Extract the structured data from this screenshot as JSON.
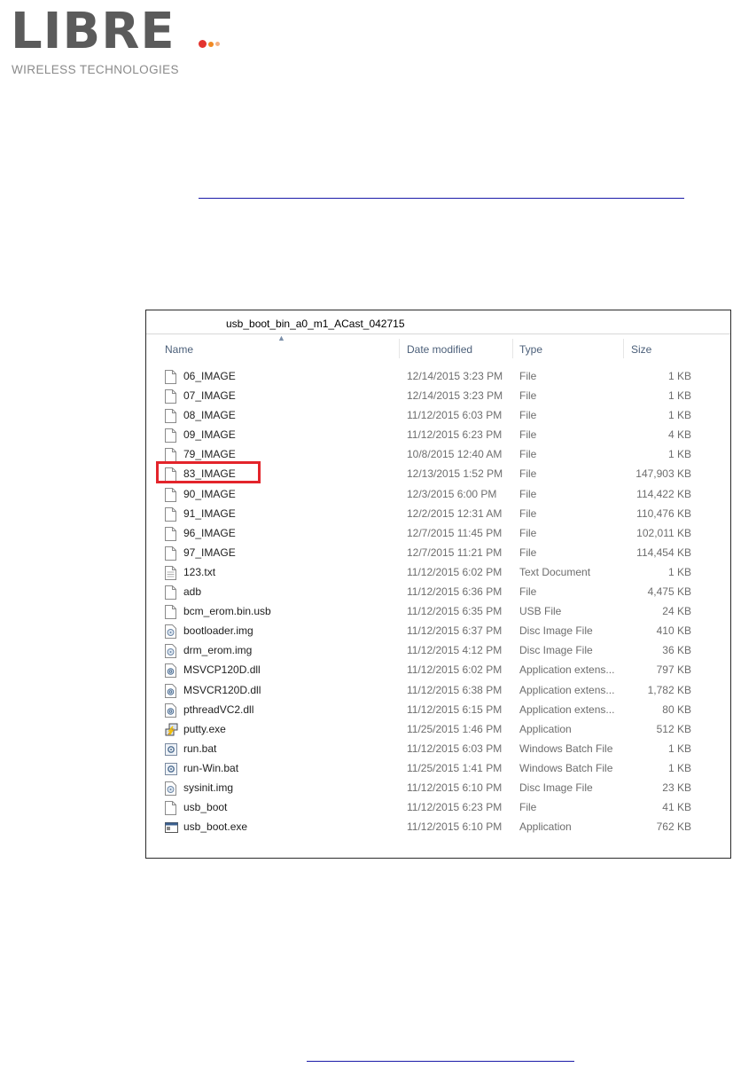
{
  "logo": {
    "wordmark": "LIBRE",
    "tagline": "WIRELESS TECHNOLOGIES",
    "dot_colors": [
      "#e3342f",
      "#f08a24",
      "#f4b183"
    ]
  },
  "explorer": {
    "folder_name": "usb_boot_bin_a0_m1_ACast_042715",
    "columns": {
      "name": "Name",
      "date": "Date modified",
      "type": "Type",
      "size": "Size"
    },
    "highlighted_file": "83_IMAGE",
    "highlight_color": "#e3242b",
    "files": [
      {
        "name": "06_IMAGE",
        "date": "12/14/2015 3:23 PM",
        "type": "File",
        "size": "1 KB",
        "icon": "blank-file-icon"
      },
      {
        "name": "07_IMAGE",
        "date": "12/14/2015 3:23 PM",
        "type": "File",
        "size": "1 KB",
        "icon": "blank-file-icon"
      },
      {
        "name": "08_IMAGE",
        "date": "11/12/2015 6:03 PM",
        "type": "File",
        "size": "1 KB",
        "icon": "blank-file-icon"
      },
      {
        "name": "09_IMAGE",
        "date": "11/12/2015 6:23 PM",
        "type": "File",
        "size": "4 KB",
        "icon": "blank-file-icon"
      },
      {
        "name": "79_IMAGE",
        "date": "10/8/2015 12:40 AM",
        "type": "File",
        "size": "1 KB",
        "icon": "blank-file-icon"
      },
      {
        "name": "83_IMAGE",
        "date": "12/13/2015 1:52 PM",
        "type": "File",
        "size": "147,903 KB",
        "icon": "blank-file-icon"
      },
      {
        "name": "90_IMAGE",
        "date": "12/3/2015 6:00 PM",
        "type": "File",
        "size": "114,422 KB",
        "icon": "blank-file-icon"
      },
      {
        "name": "91_IMAGE",
        "date": "12/2/2015 12:31 AM",
        "type": "File",
        "size": "110,476 KB",
        "icon": "blank-file-icon"
      },
      {
        "name": "96_IMAGE",
        "date": "12/7/2015 11:45 PM",
        "type": "File",
        "size": "102,011 KB",
        "icon": "blank-file-icon"
      },
      {
        "name": "97_IMAGE",
        "date": "12/7/2015 11:21 PM",
        "type": "File",
        "size": "114,454 KB",
        "icon": "blank-file-icon"
      },
      {
        "name": "123.txt",
        "date": "11/12/2015 6:02 PM",
        "type": "Text Document",
        "size": "1 KB",
        "icon": "text-file-icon"
      },
      {
        "name": "adb",
        "date": "11/12/2015 6:36 PM",
        "type": "File",
        "size": "4,475 KB",
        "icon": "blank-file-icon"
      },
      {
        "name": "bcm_erom.bin.usb",
        "date": "11/12/2015 6:35 PM",
        "type": "USB File",
        "size": "24 KB",
        "icon": "blank-file-icon"
      },
      {
        "name": "bootloader.img",
        "date": "11/12/2015 6:37 PM",
        "type": "Disc Image File",
        "size": "410 KB",
        "icon": "disc-image-icon"
      },
      {
        "name": "drm_erom.img",
        "date": "11/12/2015 4:12 PM",
        "type": "Disc Image File",
        "size": "36 KB",
        "icon": "disc-image-icon"
      },
      {
        "name": "MSVCP120D.dll",
        "date": "11/12/2015 6:02 PM",
        "type": "Application extens...",
        "size": "797 KB",
        "icon": "dll-icon"
      },
      {
        "name": "MSVCR120D.dll",
        "date": "11/12/2015 6:38 PM",
        "type": "Application extens...",
        "size": "1,782 KB",
        "icon": "dll-icon"
      },
      {
        "name": "pthreadVC2.dll",
        "date": "11/12/2015 6:15 PM",
        "type": "Application extens...",
        "size": "80 KB",
        "icon": "dll-icon"
      },
      {
        "name": "putty.exe",
        "date": "11/25/2015 1:46 PM",
        "type": "Application",
        "size": "512 KB",
        "icon": "putty-icon"
      },
      {
        "name": "run.bat",
        "date": "11/12/2015 6:03 PM",
        "type": "Windows Batch File",
        "size": "1 KB",
        "icon": "batch-file-icon"
      },
      {
        "name": "run-Win.bat",
        "date": "11/25/2015 1:41 PM",
        "type": "Windows Batch File",
        "size": "1 KB",
        "icon": "batch-file-icon"
      },
      {
        "name": "sysinit.img",
        "date": "11/12/2015 6:10 PM",
        "type": "Disc Image File",
        "size": "23 KB",
        "icon": "disc-image-icon"
      },
      {
        "name": "usb_boot",
        "date": "11/12/2015 6:23 PM",
        "type": "File",
        "size": "41 KB",
        "icon": "blank-file-icon"
      },
      {
        "name": "usb_boot.exe",
        "date": "11/12/2015 6:10 PM",
        "type": "Application",
        "size": "762 KB",
        "icon": "application-icon"
      }
    ]
  }
}
